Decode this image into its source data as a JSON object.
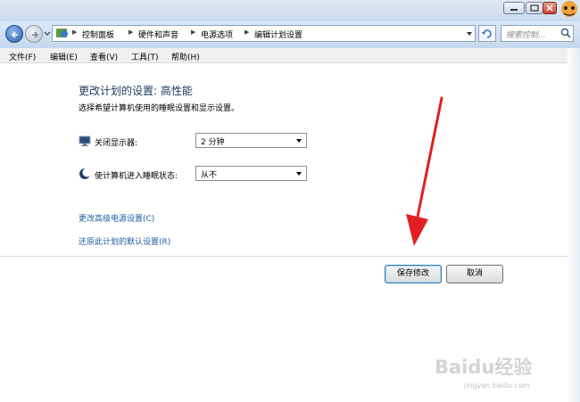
{
  "address_bar": {
    "breadcrumbs": [
      "控制面板",
      "硬件和声音",
      "电源选项",
      "编辑计划设置"
    ],
    "search_placeholder": "搜索控制..."
  },
  "menu": [
    "文件(F)",
    "编辑(E)",
    "查看(V)",
    "工具(T)",
    "帮助(H)"
  ],
  "content": {
    "title": "更改计划的设置: 高性能",
    "subtitle": "选择希望计算机使用的睡眠设置和显示设置。",
    "settings": [
      {
        "label": "关闭显示器:",
        "value": "2 分钟",
        "icon": "monitor-icon"
      },
      {
        "label": "使计算机进入睡眠状态:",
        "value": "从不",
        "icon": "moon-icon"
      }
    ],
    "links": [
      "更改高级电源设置(C)",
      "还原此计划的默认设置(R)"
    ]
  },
  "buttons": {
    "save": "保存修改",
    "cancel": "取消"
  },
  "watermark": {
    "logo": "Baidu经验",
    "url": "jingyan.baidu.com"
  },
  "colors": {
    "title": "#1e395b",
    "link": "#1e5c9f",
    "arrow": "#e02020"
  }
}
